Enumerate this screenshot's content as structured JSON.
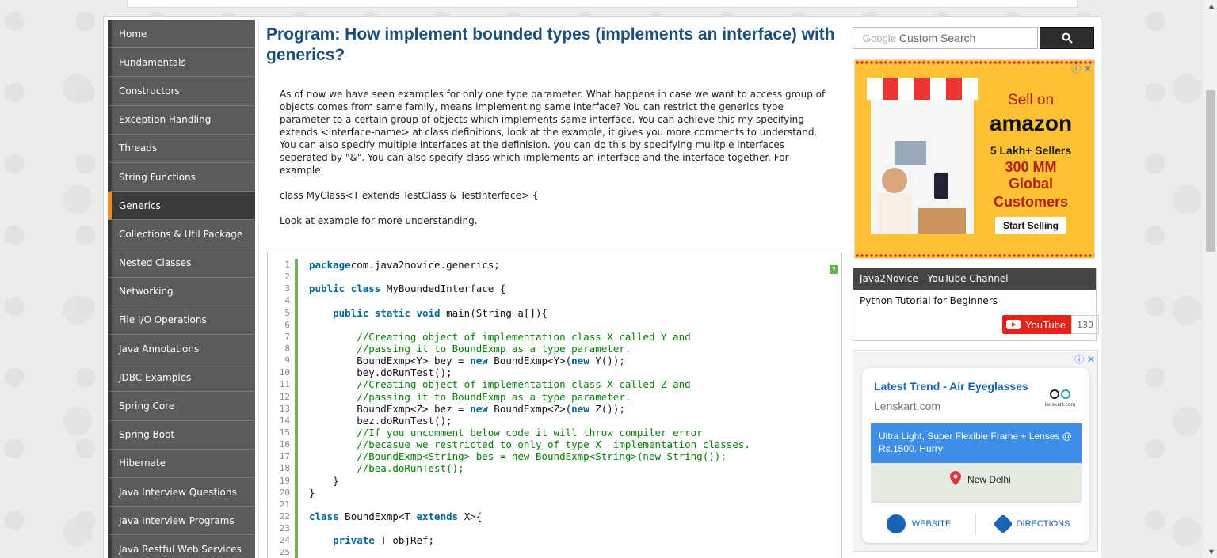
{
  "sidebar": {
    "items": [
      {
        "label": "Home"
      },
      {
        "label": "Fundamentals"
      },
      {
        "label": "Constructors"
      },
      {
        "label": "Exception Handling"
      },
      {
        "label": "Threads"
      },
      {
        "label": "String Functions"
      },
      {
        "label": "Generics",
        "active": true
      },
      {
        "label": "Collections & Util Package"
      },
      {
        "label": "Nested Classes"
      },
      {
        "label": "Networking"
      },
      {
        "label": "File I/O Operations"
      },
      {
        "label": "Java Annotations"
      },
      {
        "label": "JDBC Examples"
      },
      {
        "label": "Spring Core"
      },
      {
        "label": "Spring Boot"
      },
      {
        "label": "Hibernate"
      },
      {
        "label": "Java Interview Questions"
      },
      {
        "label": "Java Interview Programs"
      },
      {
        "label": "Java Restful Web Services"
      }
    ]
  },
  "main": {
    "title": "Program: How implement bounded types (implements an interface) with generics?",
    "paragraph1": "As of now we have seen examples for only one type parameter. What happens in case we want to access group of objects comes from same family, means implementing same interface? You can restrict the generics type parameter to a certain group of objects which implements same interface. You can achieve this my specifying extends <interface-name> at class definitions, look at the example, it gives you more comments to understand. You can also specify multiple interfaces at the definision. you can do this by specifying mulitple interfaces seperated by \"&\". You can also specify class which implements an interface and the interface together. For example:",
    "paragraph2": "class MyClass<T extends TestClass & TestInterface> {",
    "paragraph3": "Look at example for more understanding.",
    "help_label": "?"
  },
  "code": {
    "lines": [
      [
        [
          "kw",
          "package"
        ],
        [
          "",
          "com.java2novice.generics;"
        ]
      ],
      [],
      [
        [
          "kw",
          "public class"
        ],
        [
          "",
          " MyBoundedInterface {"
        ]
      ],
      [],
      [
        [
          "",
          "    "
        ],
        [
          "kw",
          "public static void"
        ],
        [
          "",
          " main(String a[]){"
        ]
      ],
      [],
      [
        [
          "cm",
          "        //Creating object of implementation class X called Y and"
        ]
      ],
      [
        [
          "cm",
          "        //passing it to BoundExmp as a type parameter."
        ]
      ],
      [
        [
          "",
          "        BoundExmp<Y> bey = "
        ],
        [
          "kw",
          "new"
        ],
        [
          "",
          " BoundExmp<Y>("
        ],
        [
          "kw",
          "new"
        ],
        [
          "",
          " Y());"
        ]
      ],
      [
        [
          "",
          "        bey.doRunTest();"
        ]
      ],
      [
        [
          "cm",
          "        //Creating object of implementation class X called Z and"
        ]
      ],
      [
        [
          "cm",
          "        //passing it to BoundExmp as a type parameter."
        ]
      ],
      [
        [
          "",
          "        BoundExmp<Z> bez = "
        ],
        [
          "kw",
          "new"
        ],
        [
          "",
          " BoundExmp<Z>("
        ],
        [
          "kw",
          "new"
        ],
        [
          "",
          " Z());"
        ]
      ],
      [
        [
          "",
          "        bez.doRunTest();"
        ]
      ],
      [
        [
          "cm",
          "        //If you uncomment below code it will throw compiler error"
        ]
      ],
      [
        [
          "cm",
          "        //becasue we restricted to only of type X  implementation classes."
        ]
      ],
      [
        [
          "cm",
          "        //BoundExmp<String> bes = new BoundExmp<String>(new String());"
        ]
      ],
      [
        [
          "cm",
          "        //bea.doRunTest();"
        ]
      ],
      [
        [
          "",
          "    }"
        ]
      ],
      [
        [
          "",
          "}"
        ]
      ],
      [],
      [
        [
          "kw",
          "class"
        ],
        [
          "",
          " BoundExmp<T "
        ],
        [
          "kw",
          "extends"
        ],
        [
          "",
          " X>{"
        ]
      ],
      [],
      [
        [
          "",
          "    "
        ],
        [
          "kw",
          "private"
        ],
        [
          "",
          " T objRef;"
        ]
      ],
      []
    ]
  },
  "search": {
    "brand": "Google",
    "placeholder": "Custom Search"
  },
  "ad1": {
    "line1": "Sell on",
    "brand": "amazon",
    "line2": "5 Lakh+ Sellers",
    "line3": "300 MM Global",
    "line4": "Customers",
    "cta": "Start Selling"
  },
  "youtube": {
    "heading": "Java2Novice - YouTube Channel",
    "video_title": "Python Tutorial for Beginners",
    "button_label": "YouTube",
    "count": "139"
  },
  "ad2": {
    "title": "Latest Trend - Air Eyeglasses",
    "domain": "Lenskart.com",
    "logo_text": "lenskart.com",
    "promo": "Ultra Light, Super Flexible Frame + Lenses @ Rs.1500. Hurry!",
    "map_label": "New Delhi",
    "website_label": "WEBSITE",
    "directions_label": "DIRECTIONS"
  },
  "colors": {
    "accent": "#f08a24",
    "title": "#1b4e7a",
    "keyword": "#006699",
    "comment": "#008200"
  }
}
